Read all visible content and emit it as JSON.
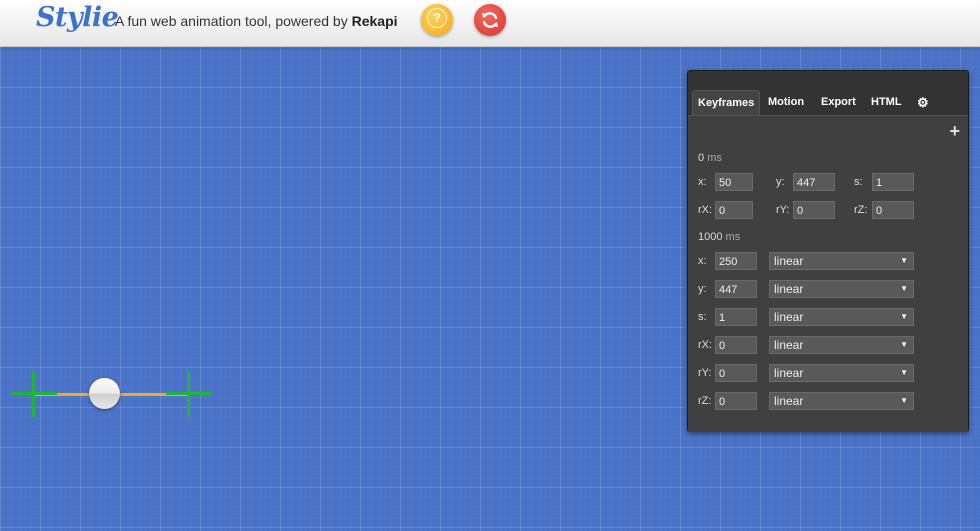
{
  "header": {
    "logo": "Stylie",
    "tagline_prefix": "A fun web animation tool, powered by ",
    "tagline_brand": "Rekapi",
    "help_label": "?"
  },
  "colors": {
    "stage_bg": "#4a72c7",
    "path": "#f0a92a",
    "crosshair": "#21b33a",
    "help_btn": "#f2a81c",
    "refresh_btn": "#d9312b",
    "panel_bg": "#333333"
  },
  "icons": {
    "help": "question-icon",
    "refresh": "refresh-icon",
    "settings": "gear-icon",
    "add": "plus-icon"
  },
  "panel": {
    "tabs": [
      "Keyframes",
      "Motion",
      "Export",
      "HTML"
    ],
    "settings_glyph": "⚙",
    "add_glyph": "+",
    "keyframes": [
      {
        "time": "0",
        "unit": "ms",
        "x_label": "x:",
        "x": "50",
        "y_label": "y:",
        "y": "447",
        "s_label": "s:",
        "s": "1",
        "rx_label": "rX:",
        "rx": "0",
        "ry_label": "rY:",
        "ry": "0",
        "rz_label": "rZ:",
        "rz": "0"
      },
      {
        "time": "1000",
        "unit": "ms",
        "props": [
          {
            "label": "x:",
            "value": "250",
            "easing": "linear"
          },
          {
            "label": "y:",
            "value": "447",
            "easing": "linear"
          },
          {
            "label": "s:",
            "value": "1",
            "easing": "linear"
          },
          {
            "label": "rX:",
            "value": "0",
            "easing": "linear"
          },
          {
            "label": "rY:",
            "value": "0",
            "easing": "linear"
          },
          {
            "label": "rZ:",
            "value": "0",
            "easing": "linear"
          }
        ]
      }
    ]
  }
}
